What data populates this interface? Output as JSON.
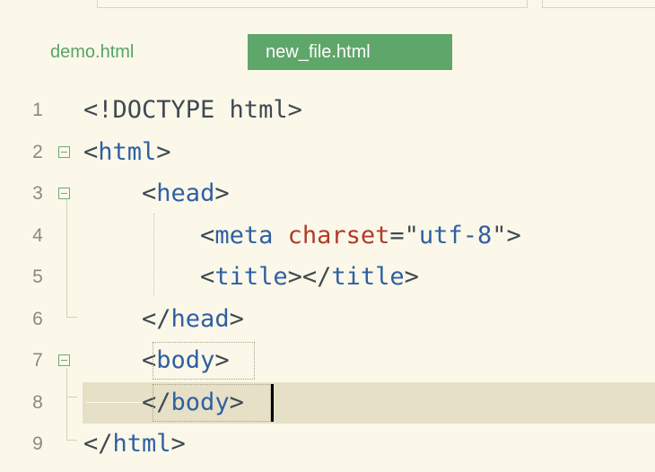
{
  "tabs": [
    {
      "label": "demo.html",
      "active": false
    },
    {
      "label": "new_file.html",
      "active": true
    }
  ],
  "editor": {
    "lines": [
      {
        "num": "1",
        "fold": false,
        "indent": "",
        "parts": [
          [
            "p",
            "<!DOCTYPE html>"
          ]
        ]
      },
      {
        "num": "2",
        "fold": true,
        "indent": "",
        "parts": [
          [
            "p",
            "<"
          ],
          [
            "t",
            "html"
          ],
          [
            "p",
            ">"
          ]
        ]
      },
      {
        "num": "3",
        "fold": true,
        "indent": "    ",
        "parts": [
          [
            "p",
            "<"
          ],
          [
            "t",
            "head"
          ],
          [
            "p",
            ">"
          ]
        ]
      },
      {
        "num": "4",
        "fold": false,
        "indent": "        ",
        "parts": [
          [
            "p",
            "<"
          ],
          [
            "t",
            "meta"
          ],
          [
            "p",
            " "
          ],
          [
            "a",
            "charset"
          ],
          [
            "p",
            "=\""
          ],
          [
            "s",
            "utf-8"
          ],
          [
            "p",
            "\">"
          ]
        ]
      },
      {
        "num": "5",
        "fold": false,
        "indent": "        ",
        "parts": [
          [
            "p",
            "<"
          ],
          [
            "t",
            "title"
          ],
          [
            "p",
            "></"
          ],
          [
            "t",
            "title"
          ],
          [
            "p",
            ">"
          ]
        ]
      },
      {
        "num": "6",
        "fold": false,
        "indent": "    ",
        "parts": [
          [
            "p",
            "</"
          ],
          [
            "t",
            "head"
          ],
          [
            "p",
            ">"
          ]
        ]
      },
      {
        "num": "7",
        "fold": true,
        "indent": "    ",
        "parts": [
          [
            "p",
            "<"
          ],
          [
            "t",
            "body"
          ],
          [
            "p",
            ">"
          ]
        ]
      },
      {
        "num": "8",
        "fold": false,
        "indent": "    ",
        "parts": [
          [
            "p",
            "</"
          ],
          [
            "t",
            "body"
          ],
          [
            "p",
            ">"
          ]
        ],
        "current": true
      },
      {
        "num": "9",
        "fold": false,
        "indent": "",
        "parts": [
          [
            "p",
            "</"
          ],
          [
            "t",
            "html"
          ],
          [
            "p",
            ">"
          ]
        ]
      }
    ]
  }
}
